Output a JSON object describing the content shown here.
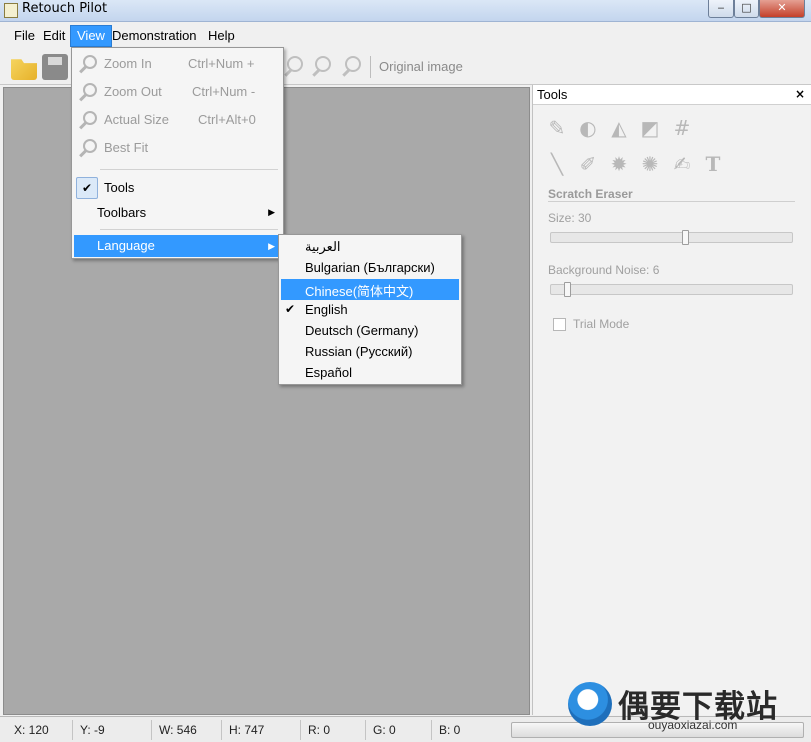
{
  "window": {
    "title": "Retouch Pilot"
  },
  "menubar": {
    "items": [
      {
        "label": "File"
      },
      {
        "label": "Edit"
      },
      {
        "label": "View",
        "active": true
      },
      {
        "label": "Demonstration"
      },
      {
        "label": "Help"
      }
    ]
  },
  "toolbar": {
    "original_image_label": "Original image"
  },
  "view_menu": {
    "zoom_in": {
      "label": "Zoom In",
      "shortcut": "Ctrl+Num +"
    },
    "zoom_out": {
      "label": "Zoom Out",
      "shortcut": "Ctrl+Num -"
    },
    "actual_size": {
      "label": "Actual Size",
      "shortcut": "Ctrl+Alt+0"
    },
    "best_fit": {
      "label": "Best Fit"
    },
    "tools": {
      "label": "Tools",
      "checked": true
    },
    "toolbars": {
      "label": "Toolbars"
    },
    "language": {
      "label": "Language",
      "highlighted": true
    }
  },
  "language_menu": {
    "items": [
      {
        "label": "العربية"
      },
      {
        "label": "Bulgarian (Български)"
      },
      {
        "label": "Chinese(简体中文)",
        "highlighted": true
      },
      {
        "label": "English",
        "checked": true
      },
      {
        "label": "Deutsch (Germany)"
      },
      {
        "label": "Russian (Русский)"
      },
      {
        "label": "Español"
      }
    ]
  },
  "tools_panel": {
    "title": "Tools",
    "close_glyph": "×",
    "tool_name": "Scratch Eraser",
    "size_label": "Size: 30",
    "size_value": 30,
    "noise_label": "Background Noise: 6",
    "noise_value": 6,
    "trial_mode_label": "Trial Mode",
    "trial_mode_checked": false
  },
  "statusbar": {
    "x": "X: 120",
    "y": "Y: -9",
    "w": "W: 546",
    "h": "H: 747",
    "r": "R: 0",
    "g": "G: 0",
    "b": "B: 0",
    "progress_fraction": 0.0
  },
  "watermark": {
    "text": "偶要下载站",
    "url": "ouyaoxiazai.com"
  },
  "colors": {
    "highlight": "#3399ff",
    "canvas": "#a9a9a9"
  }
}
